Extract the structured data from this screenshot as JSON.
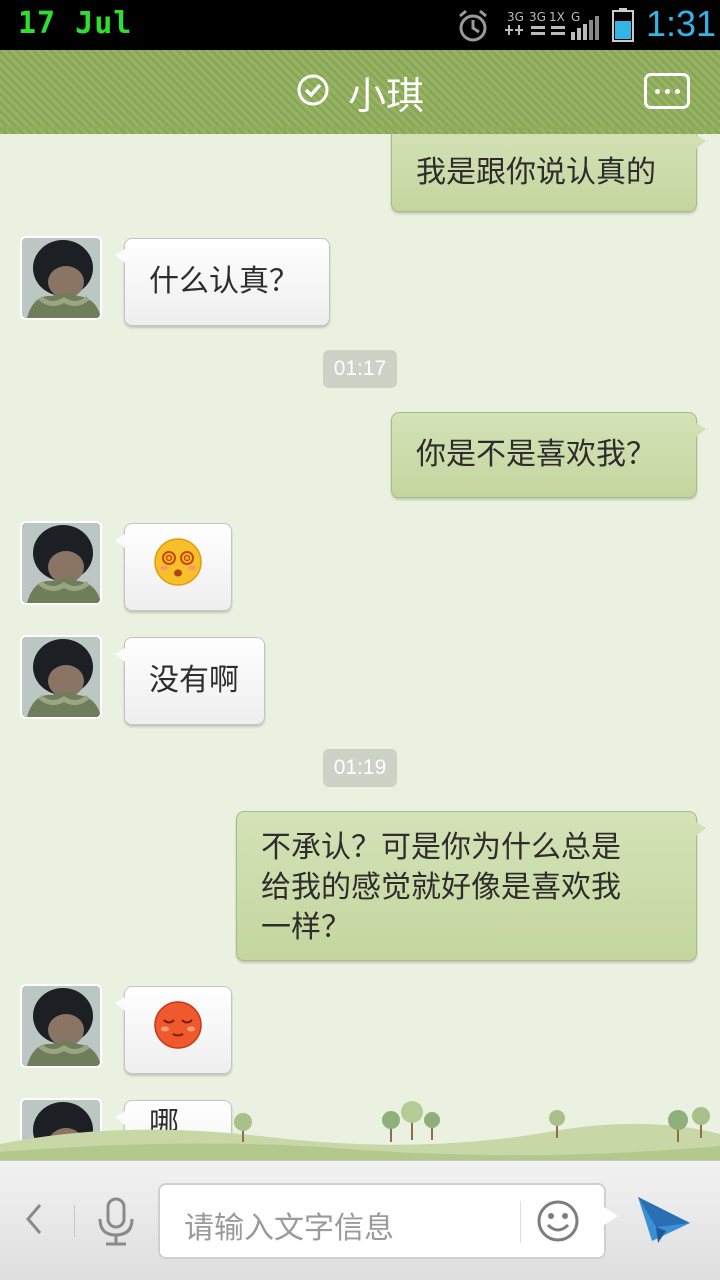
{
  "status_bar": {
    "date": "17  Jul",
    "network_3g_1": "3G",
    "network_3g_2": "3G",
    "network_1x": "1X",
    "network_g": "G",
    "time": "1:31"
  },
  "header": {
    "title": "小琪",
    "verified_icon": "check-circle-icon",
    "menu_icon": "more-dots-icon"
  },
  "messages": [
    {
      "side": "out",
      "type": "text",
      "text": "我是跟你说认真的"
    },
    {
      "side": "in",
      "type": "text",
      "text": "什么认真？"
    },
    {
      "type": "timestamp",
      "text": "01:17"
    },
    {
      "side": "out",
      "type": "text",
      "text": "你是不是喜欢我？"
    },
    {
      "side": "in",
      "type": "emoji",
      "emoji": "dizzy-face-emoji"
    },
    {
      "side": "in",
      "type": "text",
      "text": "没有啊"
    },
    {
      "type": "timestamp",
      "text": "01:19"
    },
    {
      "side": "out",
      "type": "text",
      "lines": [
        "不承认？可是你为什么总是",
        "给我的感觉就好像是喜欢我",
        "一样？"
      ]
    },
    {
      "side": "in",
      "type": "emoji",
      "emoji": "shy-face-emoji"
    },
    {
      "side": "in",
      "type": "text",
      "text": "哪有"
    }
  ],
  "input_bar": {
    "placeholder": "请输入文字信息",
    "back_icon": "chevron-left-icon",
    "mic_icon": "microphone-icon",
    "emoji_icon": "smiley-icon",
    "send_icon": "paper-plane-icon"
  },
  "colors": {
    "header": "#8fae5a",
    "outgoing_bubble": "#c8d9a6",
    "incoming_bubble": "#f7f7f7",
    "time_status": "#33b5e5",
    "date_status": "#2ee02e"
  }
}
